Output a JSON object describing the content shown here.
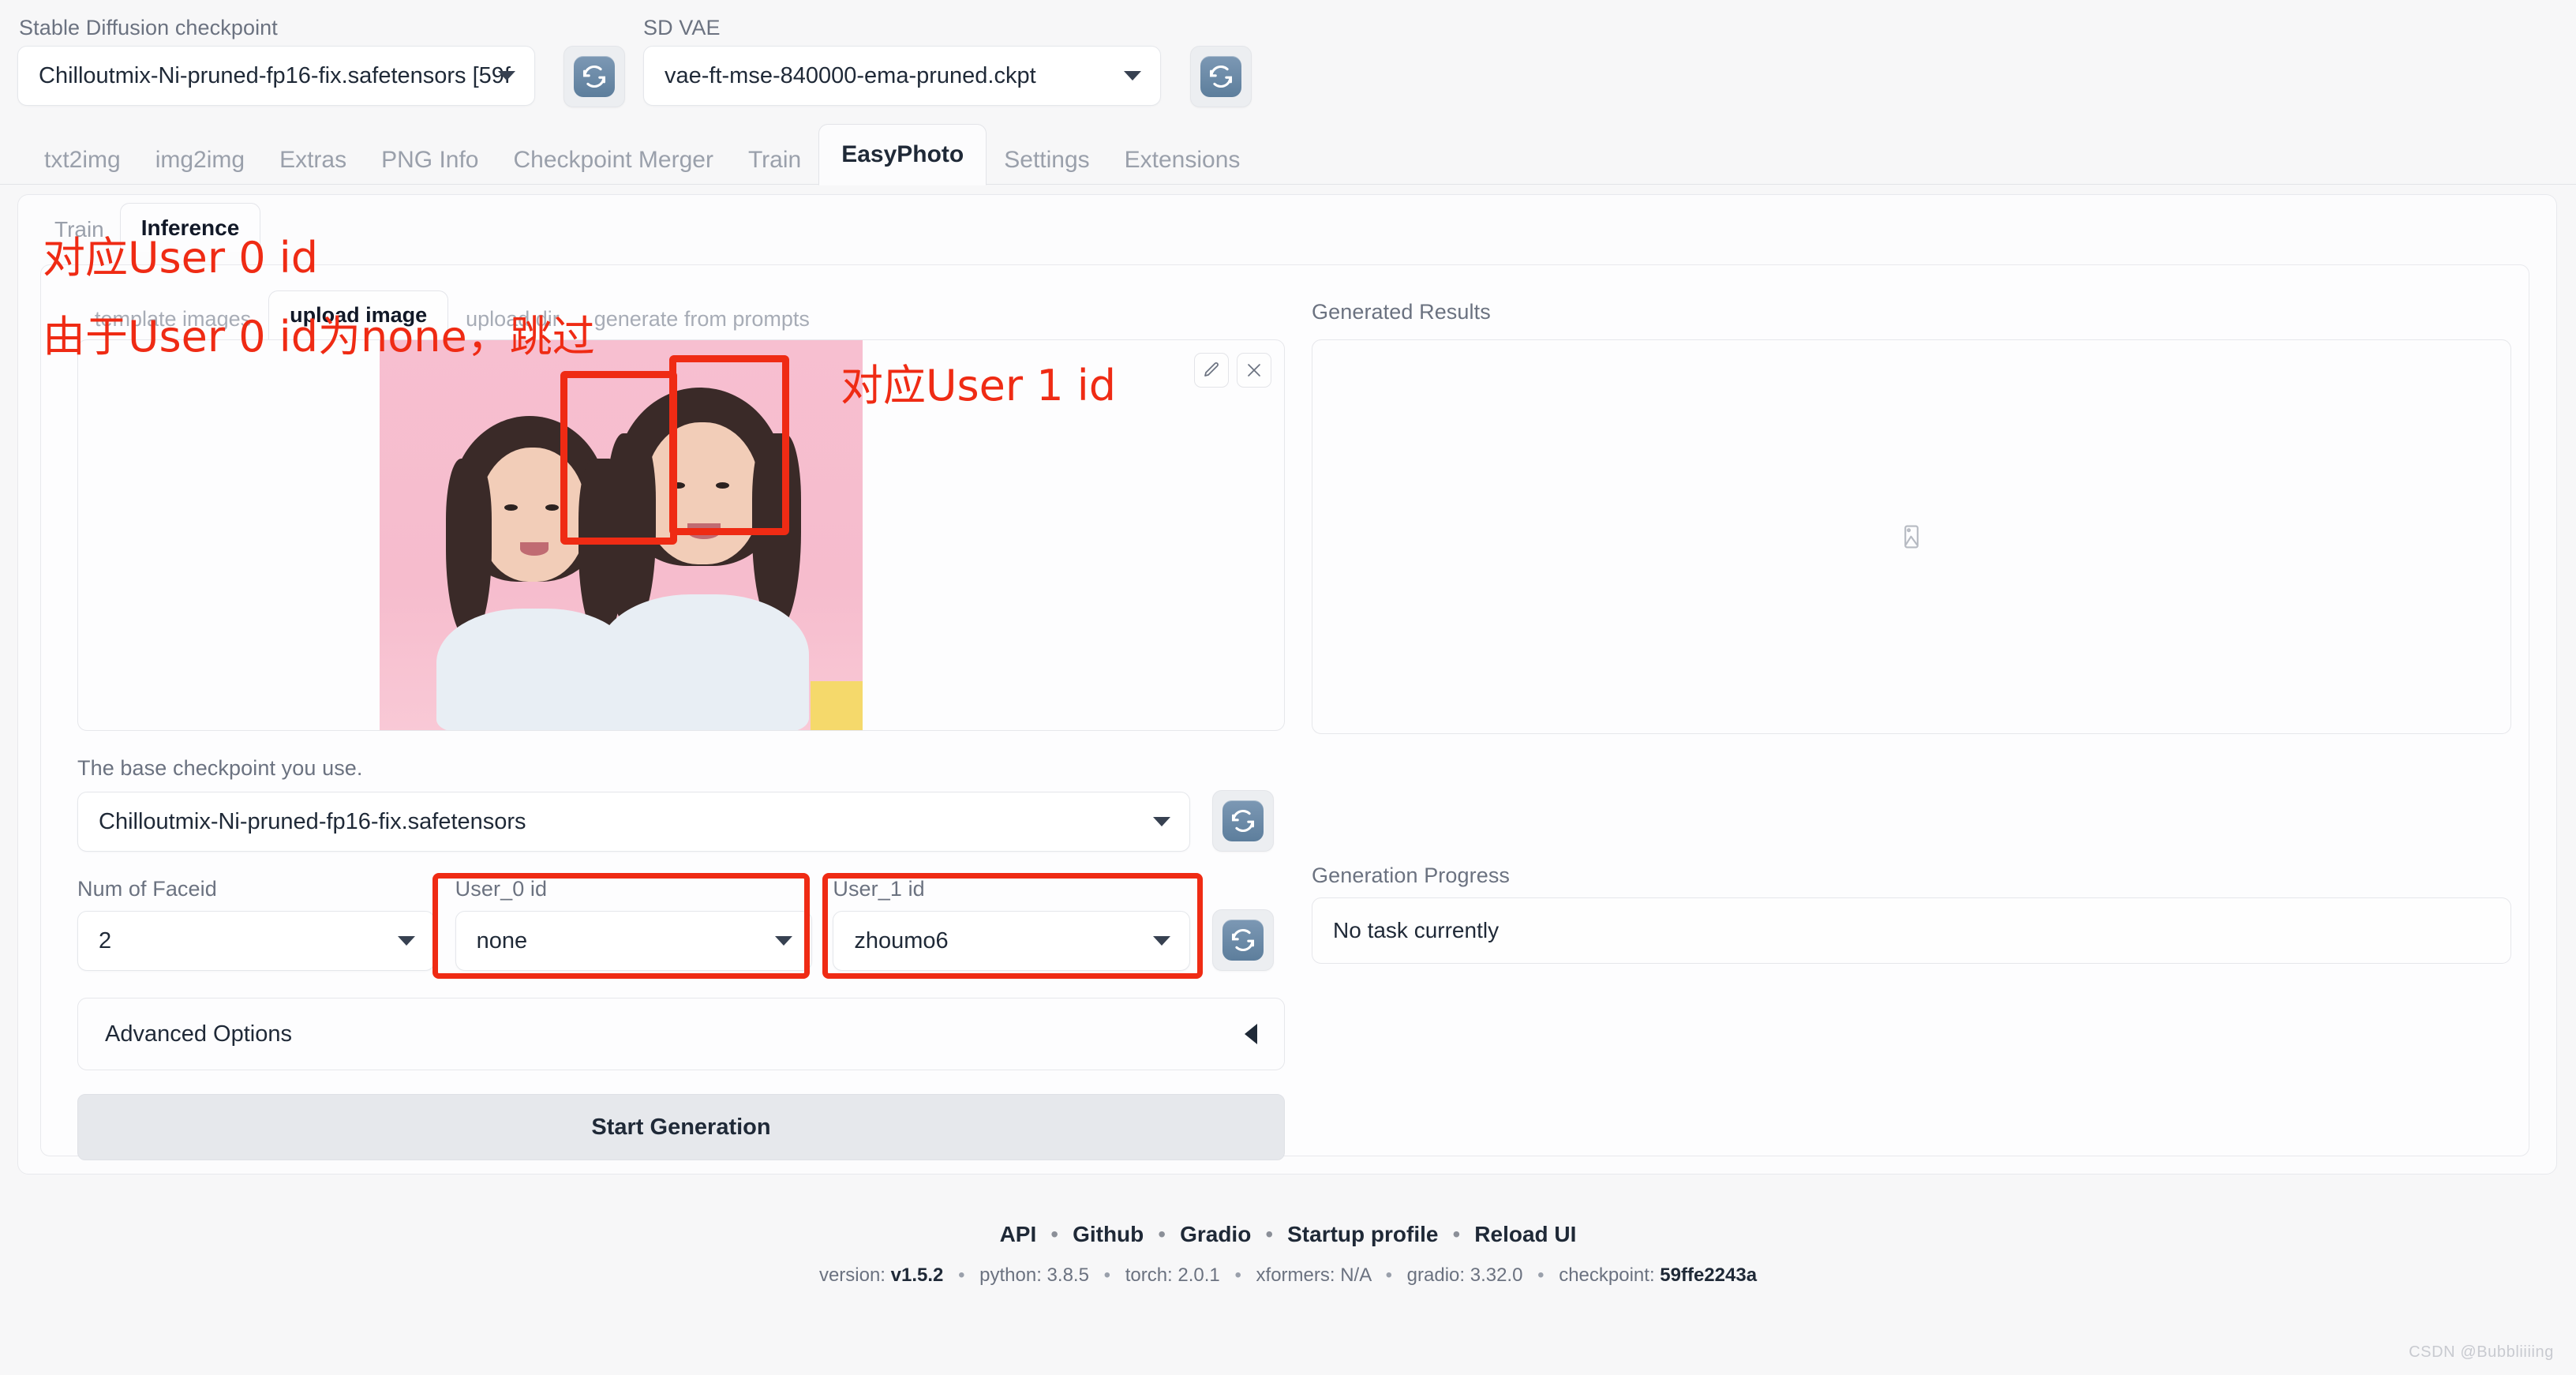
{
  "topbar": {
    "checkpoint_label": "Stable Diffusion checkpoint",
    "checkpoint_value": "Chilloutmix-Ni-pruned-fp16-fix.safetensors [59f",
    "vae_label": "SD VAE",
    "vae_value": "vae-ft-mse-840000-ema-pruned.ckpt",
    "refresh_icon": "refresh-icon"
  },
  "main_tabs": [
    {
      "label": "txt2img",
      "active": false
    },
    {
      "label": "img2img",
      "active": false
    },
    {
      "label": "Extras",
      "active": false
    },
    {
      "label": "PNG Info",
      "active": false
    },
    {
      "label": "Checkpoint Merger",
      "active": false
    },
    {
      "label": "Train",
      "active": false
    },
    {
      "label": "EasyPhoto",
      "active": true
    },
    {
      "label": "Settings",
      "active": false
    },
    {
      "label": "Extensions",
      "active": false
    }
  ],
  "sub_tabs": [
    {
      "label": "Train",
      "active": false
    },
    {
      "label": "Inference",
      "active": true
    }
  ],
  "image_tabs": [
    {
      "label": "template images",
      "active": false
    },
    {
      "label": "upload image",
      "active": true
    },
    {
      "label": "upload dir",
      "active": false
    },
    {
      "label": "generate from prompts",
      "active": false
    }
  ],
  "image_tools": {
    "edit_icon": "pencil-icon",
    "close_icon": "close-icon"
  },
  "left_panel": {
    "base_checkpoint_label": "The base checkpoint you use.",
    "base_checkpoint_value": "Chilloutmix-Ni-pruned-fp16-fix.safetensors",
    "num_faceid_label": "Num of Faceid",
    "num_faceid_value": "2",
    "user0_label": "User_0 id",
    "user0_value": "none",
    "user1_label": "User_1 id",
    "user1_value": "zhoumo6",
    "advanced_options_label": "Advanced Options",
    "start_generation_label": "Start Generation"
  },
  "right_panel": {
    "generated_results_label": "Generated Results",
    "placeholder_icon": "image-placeholder-icon",
    "generation_progress_label": "Generation Progress",
    "generation_progress_value": "No task currently"
  },
  "annotations": {
    "note_user0_ref": "对应User 0 id",
    "note_user0_none": "由于User 0 id为none，跳过",
    "note_user1_ref": "对应User 1 id",
    "color": "#ef2b14"
  },
  "footer": {
    "links": [
      "API",
      "Github",
      "Gradio",
      "Startup profile",
      "Reload UI"
    ],
    "separator": "•",
    "meta": [
      {
        "key": "version:",
        "value": "v1.5.2"
      },
      {
        "key": "python:",
        "value": "3.8.5"
      },
      {
        "key": "torch:",
        "value": "2.0.1"
      },
      {
        "key": "xformers:",
        "value": "N/A"
      },
      {
        "key": "gradio:",
        "value": "3.32.0"
      },
      {
        "key": "checkpoint:",
        "value": "59ffe2243a"
      }
    ]
  },
  "watermark": "CSDN @Bubbliiiing"
}
